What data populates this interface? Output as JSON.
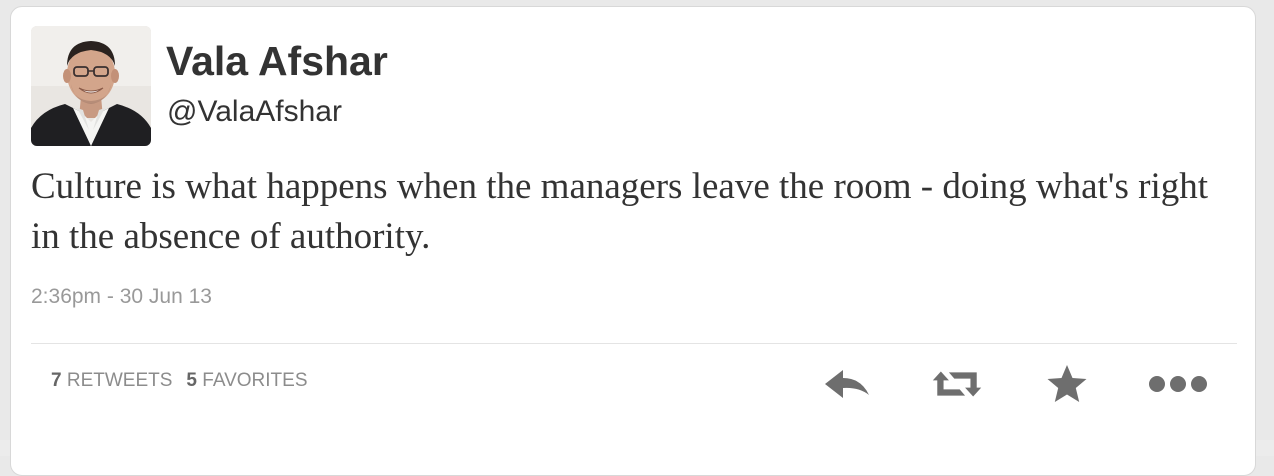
{
  "tweet": {
    "author": {
      "name": "Vala Afshar",
      "handle": "@ValaAfshar"
    },
    "text": "Culture is what happens when the managers leave the room - doing what's right in the absence of authority.",
    "timestamp": "2:36pm - 30 Jun 13",
    "stats": {
      "retweets_count": "7",
      "retweets_label": "RETWEETS",
      "favorites_count": "5",
      "favorites_label": "FAVORITES"
    },
    "actions": [
      {
        "icon": "reply-icon"
      },
      {
        "icon": "retweet-icon"
      },
      {
        "icon": "star-icon"
      },
      {
        "icon": "more-icon"
      }
    ]
  },
  "colors": {
    "text": "#333333",
    "muted": "#999999",
    "icon": "#6e6e6e",
    "divider": "#e4e4e4"
  }
}
